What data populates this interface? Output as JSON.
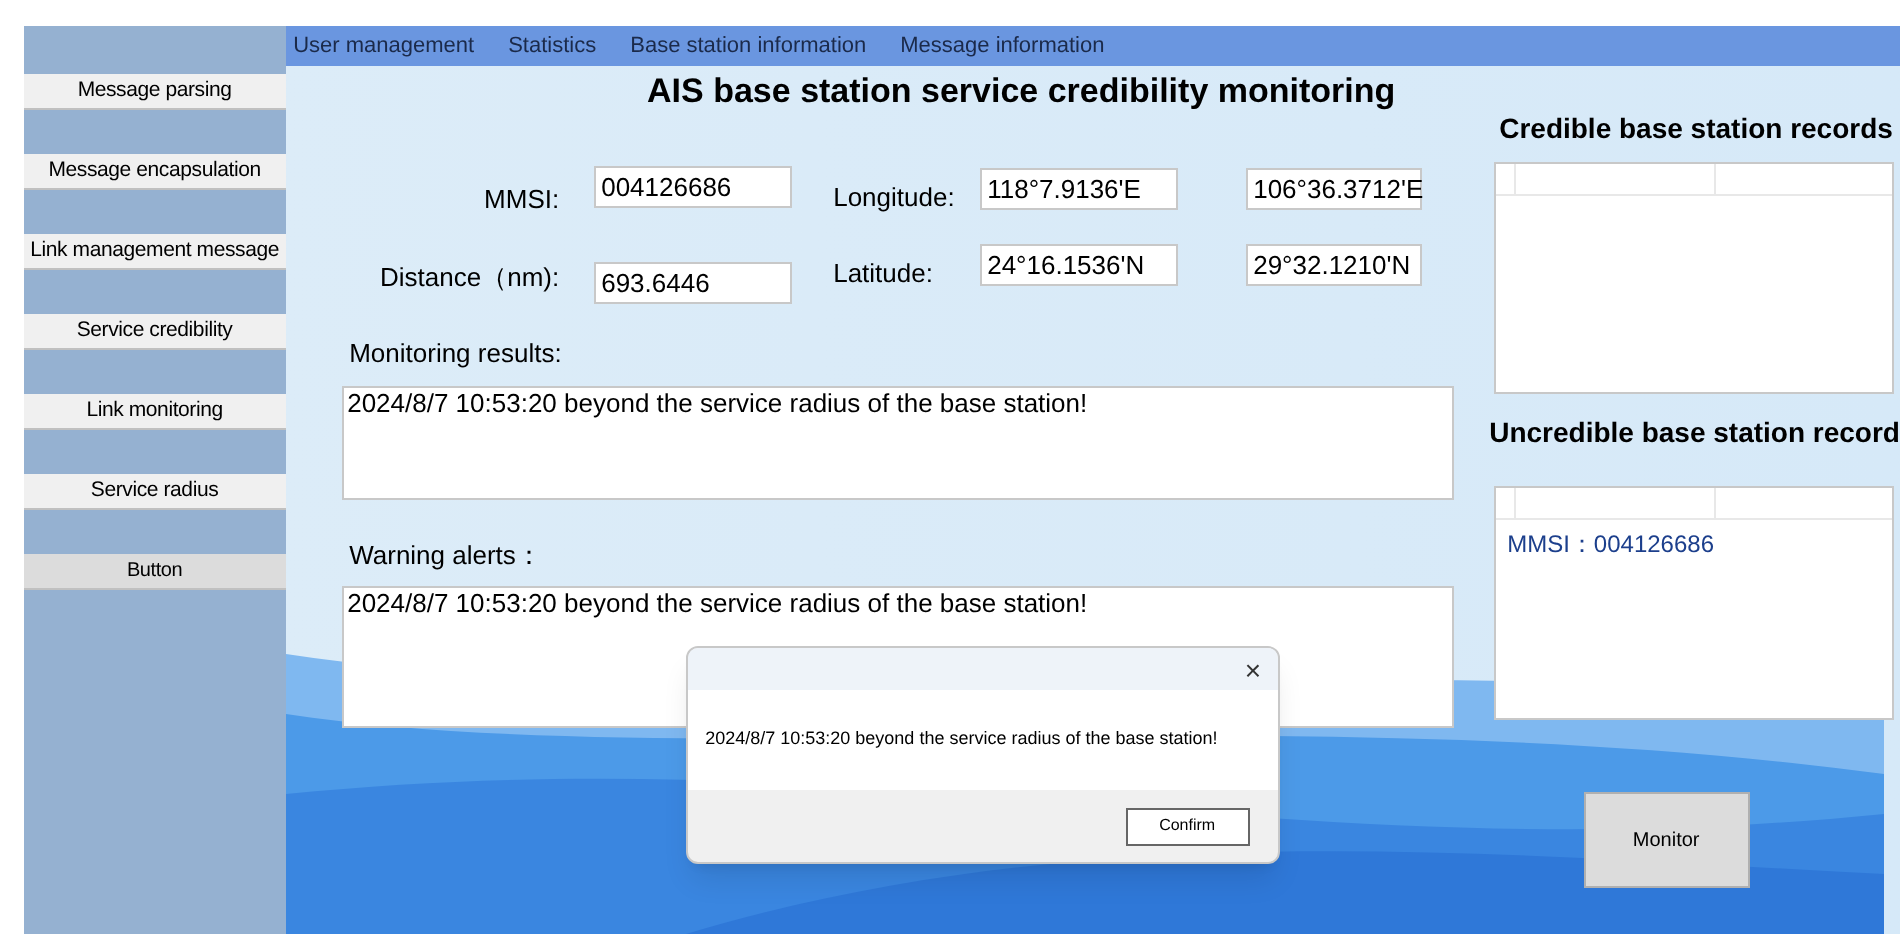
{
  "sidebar": {
    "items": [
      {
        "label": "Message parsing",
        "kind": "nav"
      },
      {
        "label": "Message encapsulation",
        "kind": "nav"
      },
      {
        "label": "Link management message",
        "kind": "nav"
      },
      {
        "label": "Service credibility",
        "kind": "nav"
      },
      {
        "label": "Link monitoring",
        "kind": "nav"
      },
      {
        "label": "Service radius",
        "kind": "nav"
      },
      {
        "label": "Button",
        "kind": "plain"
      }
    ]
  },
  "menu": [
    "User management",
    "Statistics",
    "Base station information",
    "Message information"
  ],
  "title": "AIS base station service credibility monitoring",
  "form": {
    "mmsi_label": "MMSI:",
    "mmsi": "004126686",
    "distance_label": "Distance（nm):",
    "distance": "693.6446",
    "longitude_label": "Longitude:",
    "longitude_1": "118°7.9136'E",
    "longitude_2": "106°36.3712'E",
    "latitude_label": "Latitude:",
    "latitude_1": "24°16.1536'N",
    "latitude_2": "29°32.1210'N"
  },
  "monitoring": {
    "label": "Monitoring results:",
    "text": "2024/8/7 10:53:20 beyond the service radius of the base station!"
  },
  "warnings": {
    "label": "Warning alerts：",
    "text": "2024/8/7 10:53:20 beyond the service radius of the base station!"
  },
  "credible": {
    "title": "Credible base station records"
  },
  "uncredible": {
    "title": "Uncredible base station record",
    "items": [
      "MMSI：004126686"
    ]
  },
  "monitor_button": "Monitor",
  "dialog": {
    "close": "×",
    "message": "2024/8/7 10:53:20 beyond the service radius of the base station!",
    "confirm": "Confirm"
  }
}
